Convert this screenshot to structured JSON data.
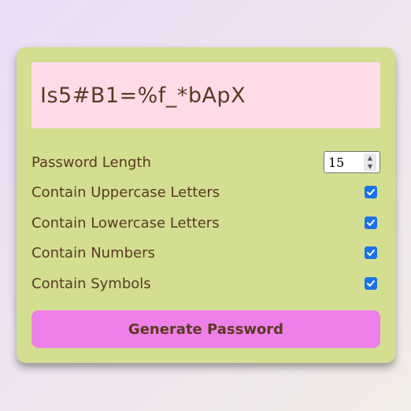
{
  "generator": {
    "password": "Is5#B1=%f_*bApX",
    "length": {
      "label": "Password Length",
      "value": "15"
    },
    "options": [
      {
        "label": "Contain Uppercase Letters",
        "checked": true
      },
      {
        "label": "Contain Lowercase Letters",
        "checked": true
      },
      {
        "label": "Contain Numbers",
        "checked": true
      },
      {
        "label": "Contain Symbols",
        "checked": true
      }
    ],
    "button_label": "Generate Password"
  },
  "colors": {
    "card": "#d3de90",
    "display": "#ffdbe8",
    "button": "#ef7fe9",
    "text": "#5a3a22",
    "checkbox": "#1a73e8"
  },
  "icons": {
    "spinner_up": "chevron-up-icon",
    "spinner_down": "chevron-down-icon",
    "check": "checkmark-icon"
  }
}
